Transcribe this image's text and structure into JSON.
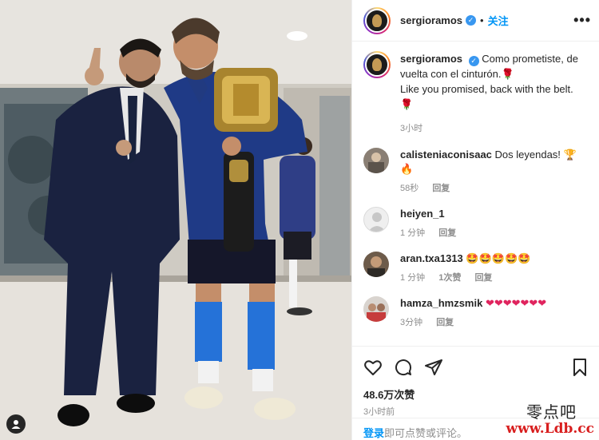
{
  "post": {
    "author": "sergioramos",
    "follow_label": "关注",
    "more_label": "•••",
    "dot": "•"
  },
  "caption": {
    "author": "sergioramos",
    "text_es": "Como prometiste, de vuelta con el cinturón.",
    "text_en": "Like you promised, back with the belt.",
    "time": "3小时"
  },
  "comments": [
    {
      "user": "calisteniaconisaac",
      "text": "Dos leyendas! 🏆🔥",
      "time": "58秒",
      "reply": "回复",
      "likes": ""
    },
    {
      "user": "heiyen_1",
      "text": "",
      "time": "1 分钟",
      "reply": "回复",
      "likes": ""
    },
    {
      "user": "aran.txa1313",
      "text": "🤩🤩🤩🤩🤩",
      "time": "1 分钟",
      "reply": "回复",
      "likes": "1次赞"
    },
    {
      "user": "hamza_hmzsmik",
      "text": "❤❤❤❤❤❤❤",
      "time": "3分钟",
      "reply": "回复",
      "likes": ""
    }
  ],
  "footer": {
    "likes": "48.6万次赞",
    "time": "3小时前",
    "login_link": "登录",
    "login_text": "即可点赞或评论。"
  },
  "watermark": {
    "line1": "零点吧",
    "line2": "www.Ldb.cc"
  },
  "colors": {
    "accent": "#0095f6",
    "verified": "#3897f0",
    "heart": "#e0245e"
  }
}
